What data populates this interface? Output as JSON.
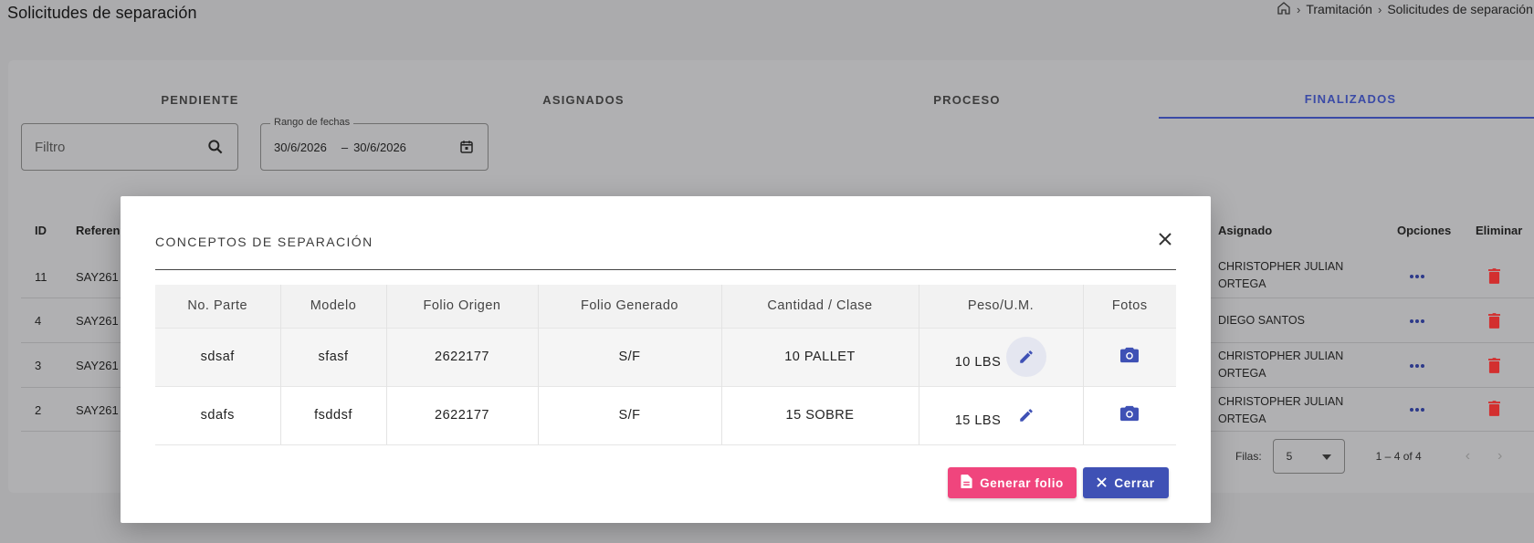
{
  "page": {
    "title": "Solicitudes de separación",
    "breadcrumb": [
      "Tramitación",
      "Solicitudes de separación"
    ]
  },
  "tabs": [
    "PENDIENTE",
    "ASIGNADOS",
    "PROCESO",
    "FINALIZADOS"
  ],
  "active_tab": "FINALIZADOS",
  "filter": {
    "placeholder": "Filtro"
  },
  "date_range": {
    "label": "Rango de fechas",
    "from": "30/6/2026",
    "sep": "–",
    "to": "30/6/2026"
  },
  "background_table": {
    "headers": {
      "id": "ID",
      "ref": "Referen",
      "assigned": "Asignado",
      "options": "Opciones",
      "delete": "Eliminar"
    },
    "rows": [
      {
        "id": "11",
        "ref": "SAY261",
        "assigned": "CHRISTOPHER JULIAN ORTEGA"
      },
      {
        "id": "4",
        "ref": "SAY261",
        "assigned": "DIEGO SANTOS"
      },
      {
        "id": "3",
        "ref": "SAY261",
        "assigned": "CHRISTOPHER JULIAN ORTEGA"
      },
      {
        "id": "2",
        "ref": "SAY261",
        "assigned": "CHRISTOPHER JULIAN ORTEGA"
      }
    ],
    "pager": {
      "rows_label": "Filas:",
      "rows_value": "5",
      "range": "1 – 4 of 4"
    }
  },
  "modal": {
    "title": "CONCEPTOS DE SEPARACIÓN",
    "headers": [
      "No. Parte",
      "Modelo",
      "Folio Origen",
      "Folio Generado",
      "Cantidad / Clase",
      "Peso/U.M.",
      "Fotos"
    ],
    "rows": [
      {
        "parte": "sdsaf",
        "modelo": "sfasf",
        "origen": "2622177",
        "generado": "S/F",
        "cantidad": "10 PALLET",
        "peso": "10 LBS"
      },
      {
        "parte": "sdafs",
        "modelo": "fsddsf",
        "origen": "2622177",
        "generado": "S/F",
        "cantidad": "15 SOBRE",
        "peso": "15 LBS"
      }
    ],
    "buttons": {
      "generate": "Generar folio",
      "close": "Cerrar"
    }
  },
  "colors": {
    "primary": "#3f51b5",
    "accent": "#f0457d",
    "danger": "#d32f2f"
  }
}
